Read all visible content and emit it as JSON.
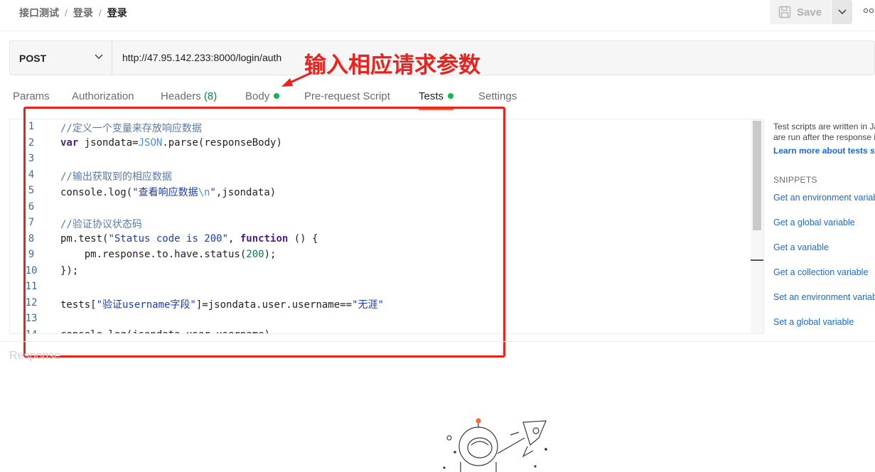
{
  "breadcrumb": {
    "collection": "接口测试",
    "folder": "登录",
    "request": "登录",
    "separator": "/"
  },
  "toolbar": {
    "save_label": "Save",
    "save_icon": "save-icon",
    "dropdown_icon": "chevron-down-icon",
    "more_icon": "more-icon"
  },
  "request": {
    "method": "POST",
    "url": "http://47.95.142.233:8000/login/auth"
  },
  "annotation": {
    "text": "输入相应请求参数",
    "color": "#e8231d"
  },
  "tabs": [
    {
      "label": "Params"
    },
    {
      "label": "Authorization"
    },
    {
      "label": "Headers",
      "count": "(8)"
    },
    {
      "label": "Body",
      "indicator": "green-dot"
    },
    {
      "label": "Pre-request Script"
    },
    {
      "label": "Tests",
      "indicator": "green-dot",
      "active": true
    },
    {
      "label": "Settings"
    }
  ],
  "editor": {
    "line_numbers": [
      "1",
      "2",
      "3",
      "4",
      "5",
      "6",
      "7",
      "8",
      "9",
      "10",
      "11",
      "12",
      "13",
      "14"
    ],
    "lines": [
      [
        {
          "t": "//定义一个变量来存放响应数据",
          "c": "cm"
        }
      ],
      [
        {
          "t": "var",
          "c": "kw"
        },
        {
          "t": " jsondata="
        },
        {
          "t": "JSON",
          "c": "obj"
        },
        {
          "t": ".parse(responseBody)"
        }
      ],
      [],
      [
        {
          "t": "//输出获取到的相应数据",
          "c": "cm"
        }
      ],
      [
        {
          "t": "console.log("
        },
        {
          "t": "\"查看响应数据",
          "c": "str"
        },
        {
          "t": "\\n",
          "c": "escp"
        },
        {
          "t": "\"",
          "c": "str"
        },
        {
          "t": ",jsondata)"
        }
      ],
      [],
      [
        {
          "t": "//验证协议状态码",
          "c": "cm"
        }
      ],
      [
        {
          "t": "pm.test("
        },
        {
          "t": "\"Status code is 200\"",
          "c": "str"
        },
        {
          "t": ", "
        },
        {
          "t": "function",
          "c": "kw"
        },
        {
          "t": " () {"
        }
      ],
      [
        {
          "t": "    pm.response.to.have.status("
        },
        {
          "t": "200",
          "c": "num"
        },
        {
          "t": ");"
        }
      ],
      [
        {
          "t": "});"
        }
      ],
      [],
      [
        {
          "t": "tests["
        },
        {
          "t": "\"验证username字段\"",
          "c": "str"
        },
        {
          "t": "]=jsondata.user.username=="
        },
        {
          "t": "\"无涯\"",
          "c": "str"
        }
      ],
      [],
      [
        {
          "t": "console.log(jsondata.user.username)"
        }
      ]
    ]
  },
  "help": {
    "line1": "Test scripts are written in JavaScript, and",
    "line2": "are run after the response is received.",
    "learn_more": "Learn more about tests scripts"
  },
  "snippets": {
    "title": "SNIPPETS",
    "items": [
      "Get an environment variable",
      "Get a global variable",
      "Get a variable",
      "Get a collection variable",
      "Set an environment variable",
      "Set a global variable"
    ]
  },
  "response": {
    "label": "Response"
  }
}
